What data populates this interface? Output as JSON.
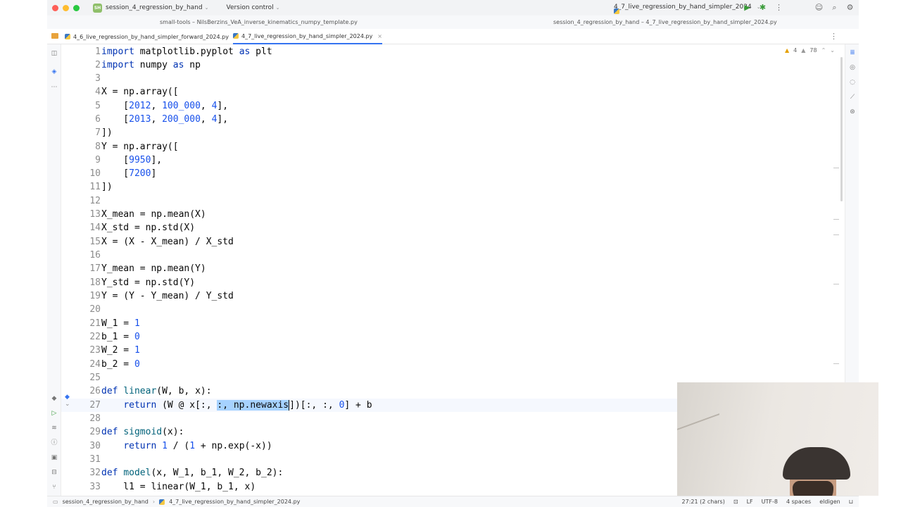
{
  "titlebar": {
    "project_badge": "SH",
    "project_name": "session_4_regression_by_hand",
    "vcs_label": "Version control",
    "run_config": "4_7_live_regression_by_hand_simpler_2024"
  },
  "window_titles": {
    "left": "small-tools – NilsBerzins_VeA_inverse_kinematics_numpy_template.py",
    "right": "session_4_regression_by_hand – 4_7_live_regression_by_hand_simpler_2024.py"
  },
  "tabs": [
    {
      "label": "4_6_live_regression_by_hand_simpler_forward_2024.py",
      "active": false
    },
    {
      "label": "4_7_live_regression_by_hand_simpler_2024.py",
      "active": true
    }
  ],
  "inspections": {
    "warnings": "4",
    "weak": "78"
  },
  "code": [
    {
      "n": "1"
    },
    {
      "n": "2"
    },
    {
      "n": "3"
    },
    {
      "n": "4"
    },
    {
      "n": "5"
    },
    {
      "n": "6"
    },
    {
      "n": "7"
    },
    {
      "n": "8"
    },
    {
      "n": "9"
    },
    {
      "n": "10"
    },
    {
      "n": "11"
    },
    {
      "n": "12"
    },
    {
      "n": "13"
    },
    {
      "n": "14"
    },
    {
      "n": "15"
    },
    {
      "n": "16"
    },
    {
      "n": "17"
    },
    {
      "n": "18"
    },
    {
      "n": "19"
    },
    {
      "n": "20"
    },
    {
      "n": "21"
    },
    {
      "n": "22"
    },
    {
      "n": "23"
    },
    {
      "n": "24"
    },
    {
      "n": "25"
    },
    {
      "n": "26"
    },
    {
      "n": "27"
    },
    {
      "n": "28"
    },
    {
      "n": "29"
    },
    {
      "n": "30"
    },
    {
      "n": "31"
    },
    {
      "n": "32"
    },
    {
      "n": "33"
    }
  ],
  "lines": {
    "l1": [
      "import",
      " matplotlib.pyplot ",
      "as",
      " plt"
    ],
    "l2": [
      "import",
      " numpy ",
      "as",
      " np"
    ],
    "l4": "X = np.array([",
    "l5": [
      "    [",
      "2012",
      ", ",
      "100_000",
      ", ",
      "4",
      "],"
    ],
    "l6": [
      "    [",
      "2013",
      ", ",
      "200_000",
      ", ",
      "4",
      "],"
    ],
    "l7": "])",
    "l8": "Y = np.array([",
    "l9": [
      "    [",
      "9950",
      "],"
    ],
    "l10": [
      "    [",
      "7200",
      "]"
    ],
    "l11": "])",
    "l13": "X_mean = np.mean(X)",
    "l14": "X_std = np.std(X)",
    "l15": "X = (X - X_mean) / X_std",
    "l17": "Y_mean = np.mean(Y)",
    "l18": "Y_std = np.std(Y)",
    "l19": "Y = (Y - Y_mean) / Y_std",
    "l21": [
      "W_1 = ",
      "1"
    ],
    "l22": [
      "b_1 = ",
      "0"
    ],
    "l23": [
      "W_2 = ",
      "1"
    ],
    "l24": [
      "b_2 = ",
      "0"
    ],
    "l26": [
      "def",
      " ",
      "linear",
      "(W, b, x):"
    ],
    "l27": [
      "    ",
      "return",
      " (W @ x[:, ",
      ":, np.newaxis",
      "])[:, :, ",
      "0",
      "] + b"
    ],
    "l29": [
      "def",
      " ",
      "sigmoid",
      "(x):"
    ],
    "l30": [
      "    ",
      "return",
      " ",
      "1",
      " / (",
      "1",
      " + np.exp(-x))"
    ],
    "l32": [
      "def",
      " ",
      "model",
      "(x, W_1, b_1, W_2, b_2):"
    ],
    "l33": "    l1 = linear(W_1, b_1, x)"
  },
  "statusbar": {
    "project": "session_4_regression_by_hand",
    "file": "4_7_live_regression_by_hand_simpler_2024.py",
    "position": "27:21 (2 chars)",
    "line_sep": "LF",
    "encoding": "UTF-8",
    "indent": "4 spaces",
    "user": "eldigen"
  },
  "icons": {
    "window_controls": [
      "close-icon",
      "minimize-icon",
      "zoom-icon"
    ],
    "toolbar": [
      "run-icon",
      "debug-icon",
      "more-icon",
      "account-icon",
      "search-icon",
      "settings-icon"
    ]
  },
  "colors": {
    "keyword": "#0033b3",
    "number": "#1750eb",
    "function": "#00627a",
    "selection": "#a6d2ff",
    "accent": "#3574f0"
  }
}
